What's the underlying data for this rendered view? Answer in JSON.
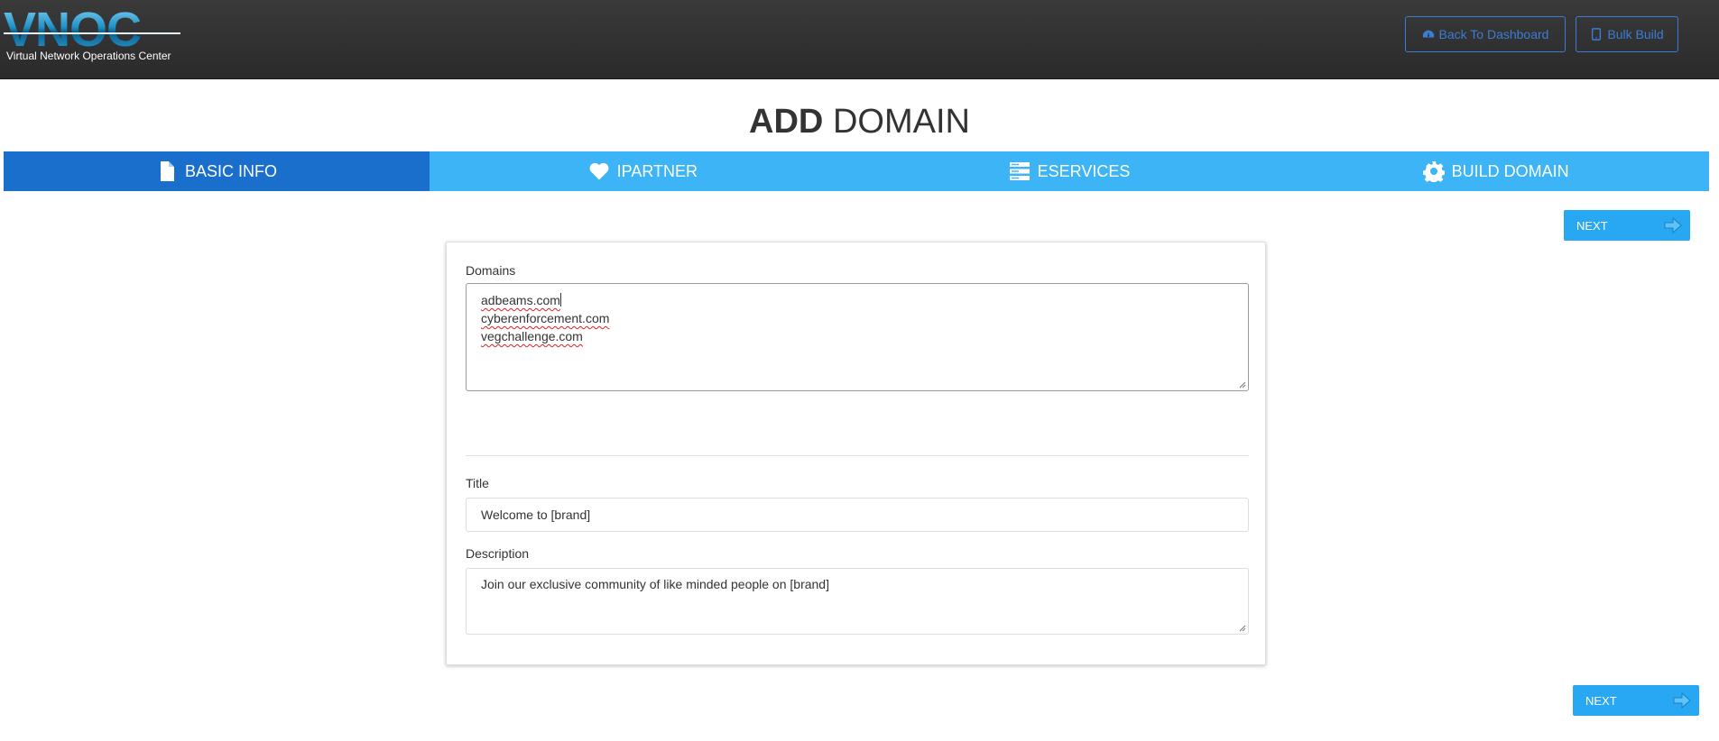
{
  "header": {
    "logo_text": "VNOC",
    "logo_subtitle": "Virtual Network Operations Center",
    "back_button": "Back To Dashboard",
    "bulk_button": "Bulk Build"
  },
  "page": {
    "title_bold": "ADD",
    "title_rest": "DOMAIN"
  },
  "tabs": [
    {
      "label": "BASIC INFO",
      "icon": "document-icon",
      "active": true
    },
    {
      "label": "IPARTNER",
      "icon": "heart-icon",
      "active": false
    },
    {
      "label": "ESERVICES",
      "icon": "server-icon",
      "active": false
    },
    {
      "label": "BUILD DOMAIN",
      "icon": "gear-icon",
      "active": false
    }
  ],
  "next_label": "NEXT",
  "form": {
    "domains_label": "Domains",
    "domains": [
      "adbeams.com",
      "cyberenforcement.com",
      "vegchallenge.com"
    ],
    "title_label": "Title",
    "title_value": "Welcome to [brand]",
    "description_label": "Description",
    "description_value": "Join our exclusive community of like minded people on [brand]"
  },
  "colors": {
    "tab_bar": "#3cb4f5",
    "tab_active": "#1b6fcc",
    "next_button": "#28a7f2",
    "header_button": "#3a7dd6"
  }
}
